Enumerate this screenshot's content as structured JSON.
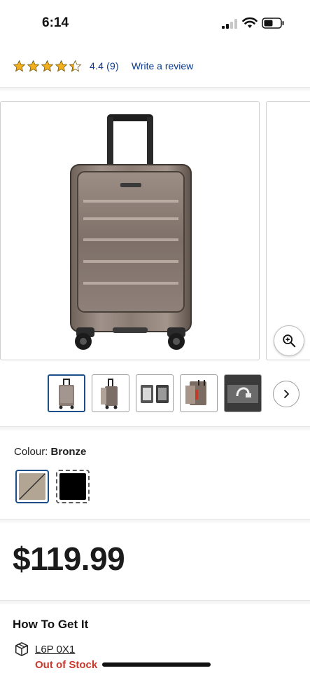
{
  "status_bar": {
    "time": "6:14"
  },
  "rating": {
    "value": "4.4",
    "count": "(9)",
    "stars_filled": 4.4,
    "star_color": "#f2b01e",
    "write_review_label": "Write a review"
  },
  "gallery": {
    "main_image": "bronze-carry-on-suitcase",
    "zoom_icon": "zoom-in-icon",
    "thumbnails": [
      {
        "name": "thumb-front",
        "selected": true
      },
      {
        "name": "thumb-side-open"
      },
      {
        "name": "thumb-interior"
      },
      {
        "name": "thumb-front-pocket"
      },
      {
        "name": "thumb-usb-port"
      }
    ]
  },
  "colour": {
    "label": "Colour:",
    "selected": "Bronze",
    "swatches": [
      {
        "name": "Bronze",
        "color": "#b3a593",
        "selected": true
      },
      {
        "name": "Black",
        "color": "#000000",
        "available": false
      }
    ]
  },
  "price": "$119.99",
  "fulfillment": {
    "title": "How To Get It",
    "postal_code": "L6P 0X1",
    "status": "Out of Stock",
    "status_color": "#c8392b"
  },
  "colors": {
    "link": "#0c3a8c",
    "selected_border": "#1c4f8a"
  }
}
